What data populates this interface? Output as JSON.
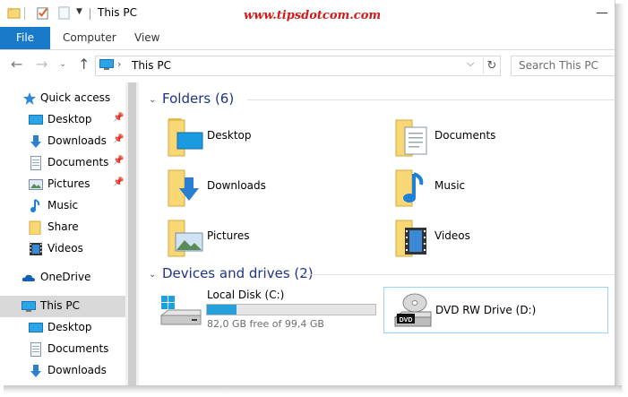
{
  "window": {
    "title": "This PC"
  },
  "watermark": "www.tipsdotcom.com",
  "ribbon": {
    "tabs": [
      "File",
      "Computer",
      "View"
    ]
  },
  "address": {
    "location": "This PC",
    "search_placeholder": "Search This PC"
  },
  "nav": {
    "quick_access": "Quick access",
    "quick_items": [
      {
        "label": "Desktop",
        "pinned": true,
        "icon": "desktop-icon"
      },
      {
        "label": "Downloads",
        "pinned": true,
        "icon": "downloads-icon"
      },
      {
        "label": "Documents",
        "pinned": true,
        "icon": "documents-icon"
      },
      {
        "label": "Pictures",
        "pinned": true,
        "icon": "pictures-icon"
      },
      {
        "label": "Music",
        "pinned": false,
        "icon": "music-icon"
      },
      {
        "label": "Share",
        "pinned": false,
        "icon": "folder-icon"
      },
      {
        "label": "Videos",
        "pinned": false,
        "icon": "videos-icon"
      }
    ],
    "onedrive": "OneDrive",
    "this_pc": "This PC",
    "pc_items": [
      {
        "label": "Desktop",
        "icon": "desktop-icon"
      },
      {
        "label": "Documents",
        "icon": "documents-icon"
      },
      {
        "label": "Downloads",
        "icon": "downloads-icon"
      }
    ]
  },
  "content": {
    "folders_header": "Folders (6)",
    "folders": [
      {
        "label": "Desktop",
        "icon": "desktop-folder-icon"
      },
      {
        "label": "Documents",
        "icon": "documents-folder-icon"
      },
      {
        "label": "Downloads",
        "icon": "downloads-folder-icon"
      },
      {
        "label": "Music",
        "icon": "music-folder-icon"
      },
      {
        "label": "Pictures",
        "icon": "pictures-folder-icon"
      },
      {
        "label": "Videos",
        "icon": "videos-folder-icon"
      }
    ],
    "drives_header": "Devices and drives (2)",
    "drives": [
      {
        "label": "Local Disk (C:)",
        "free_text": "82,0 GB free of 99,4 GB",
        "used_fraction": 0.175,
        "icon": "hard-disk-icon"
      },
      {
        "label": "DVD RW Drive (D:)",
        "icon": "dvd-drive-icon"
      }
    ]
  },
  "colors": {
    "accent": "#1979ca",
    "header": "#1e3287",
    "watermark": "#d11a1a",
    "drive_bar": "#26a0da",
    "folder": "#f8d775"
  }
}
